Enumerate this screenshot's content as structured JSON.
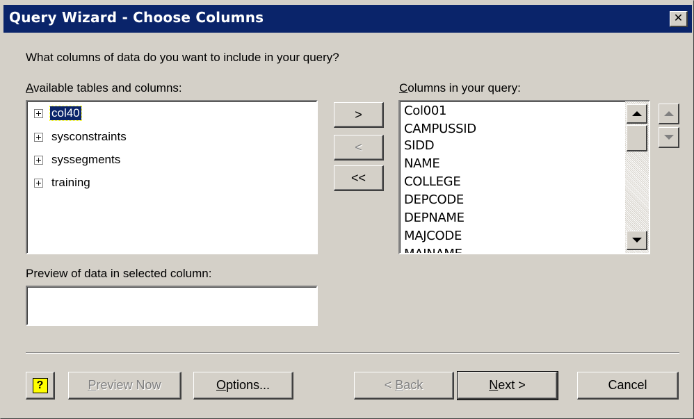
{
  "window": {
    "title": "Query Wizard - Choose Columns",
    "close_glyph": "✕"
  },
  "prompt": "What columns of data do you want to include in your query?",
  "available": {
    "label_mnemonic": "A",
    "label_rest": "vailable tables and columns:",
    "items": [
      {
        "label": "col40",
        "selected": true
      },
      {
        "label": "sysconstraints",
        "selected": false
      },
      {
        "label": "syssegments",
        "selected": false
      },
      {
        "label": "training",
        "selected": false
      }
    ]
  },
  "move_buttons": {
    "add": ">",
    "remove": "<",
    "remove_all": "<<"
  },
  "query": {
    "label_mnemonic": "C",
    "label_rest": "olumns in your query:",
    "items": [
      "Col001",
      "CAMPUSSID",
      "SIDD",
      "NAME",
      "COLLEGE",
      "DEPCODE",
      "DEPNAME",
      "MAJCODE",
      "MAJNAME"
    ]
  },
  "preview": {
    "label": "Preview of data in selected column:",
    "value": ""
  },
  "footer": {
    "help_glyph": "?",
    "preview_now_mnemonic": "P",
    "preview_now_rest": "review Now",
    "options_mnemonic": "O",
    "options_rest": "ptions...",
    "back_pre": "< ",
    "back_mnemonic": "B",
    "back_rest": "ack",
    "next_mnemonic": "N",
    "next_rest": "ext >",
    "cancel": "Cancel"
  },
  "colors": {
    "titlebar": "#0a246a",
    "face": "#d4d0c8",
    "selection": "#0a246a"
  }
}
